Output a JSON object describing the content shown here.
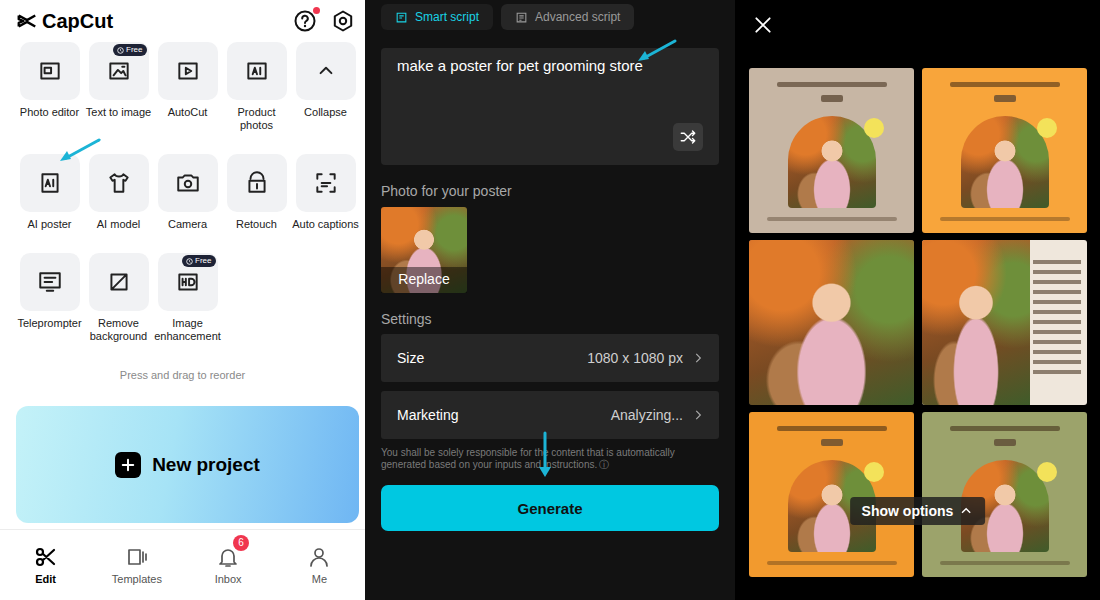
{
  "home": {
    "logo": "CapCut",
    "help_dot": true,
    "tools": [
      {
        "label": "Photo editor"
      },
      {
        "label": "Text to image",
        "badge": "Free"
      },
      {
        "label": "AutoCut"
      },
      {
        "label": "Product photos"
      },
      {
        "label": "Collapse"
      },
      {
        "label": "AI poster"
      },
      {
        "label": "AI model"
      },
      {
        "label": "Camera"
      },
      {
        "label": "Retouch"
      },
      {
        "label": "Auto captions"
      },
      {
        "label": "Teleprompter"
      },
      {
        "label": "Remove background"
      },
      {
        "label": "Image enhancement",
        "badge": "Free"
      }
    ],
    "hint": "Press and drag to reorder",
    "new_project": "New project",
    "nav": [
      {
        "label": "Edit",
        "selected": true
      },
      {
        "label": "Templates",
        "selected": false
      },
      {
        "label": "Inbox",
        "selected": false,
        "badge": "6"
      },
      {
        "label": "Me",
        "selected": false
      }
    ]
  },
  "editor": {
    "tabs": [
      {
        "label": "Smart script",
        "selected": true
      },
      {
        "label": "Advanced script",
        "selected": false
      }
    ],
    "prompt": "make a poster for pet grooming store",
    "photo_label": "Photo for your poster",
    "replace": "Replace",
    "settings_title": "Settings",
    "settings": [
      {
        "label": "Size",
        "value": "1080 x 1080 px"
      },
      {
        "label": "Marketing",
        "value": "Analyzing..."
      }
    ],
    "disclaimer": "You shall be solely responsible for the content that is automatically generated based on your inputs and instructions.",
    "info": "ⓘ",
    "generate": "Generate"
  },
  "results": {
    "posters": [
      {
        "kind": "framed",
        "color": "#c7b6a4"
      },
      {
        "kind": "framed",
        "color": "#f8a53b"
      },
      {
        "kind": "full"
      },
      {
        "kind": "split",
        "color": "#efe7dc"
      },
      {
        "kind": "framed",
        "color": "#f29a2e"
      },
      {
        "kind": "framed",
        "color": "#9ca36b"
      }
    ],
    "show_options": "Show options"
  }
}
